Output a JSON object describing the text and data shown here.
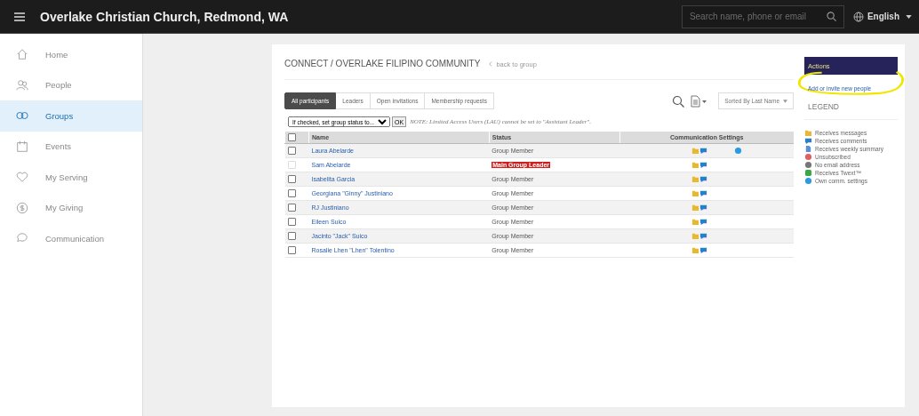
{
  "header": {
    "title": "Overlake Christian Church, Redmond, WA",
    "search": {
      "placeholder": "Search name, phone or email"
    },
    "language": "English"
  },
  "sidebar": {
    "items": [
      {
        "label": "Home",
        "selected": false
      },
      {
        "label": "People",
        "selected": false
      },
      {
        "label": "Groups",
        "selected": true
      },
      {
        "label": "Events",
        "selected": false
      },
      {
        "label": "My Serving",
        "selected": false
      },
      {
        "label": "My Giving",
        "selected": false
      },
      {
        "label": "Communication",
        "selected": false
      }
    ]
  },
  "breadcrumb": {
    "title": "CONNECT / OVERLAKE FILIPINO COMMUNITY",
    "back_link": "back to group"
  },
  "tabs": [
    {
      "label": "All participants",
      "selected": true
    },
    {
      "label": "Leaders",
      "selected": false
    },
    {
      "label": "Open invitations",
      "selected": false
    },
    {
      "label": "Membership requests",
      "selected": false
    }
  ],
  "sort": {
    "value": "Sorted By Last Name"
  },
  "bulk": {
    "select": "If checked, set group status to...",
    "button": "OK",
    "note": "NOTE: Limited Access Users (LAU) cannot be set to \"Assistant Leader\"."
  },
  "table": {
    "select_all_checked": false,
    "columns": [
      "Name",
      "Status",
      "Communication Settings"
    ],
    "rows": [
      {
        "name": "Laura Abelarde",
        "status": "Group Member",
        "leader": false,
        "checked": false,
        "disabled": false,
        "comm": [
          {
            "kind": "messages"
          },
          {
            "kind": "comments"
          },
          {
            "kind": "own"
          }
        ]
      },
      {
        "name": "Sam Abelarde",
        "status": "Main Group Leader",
        "leader": true,
        "checked": false,
        "disabled": true,
        "comm": [
          {
            "kind": "messages"
          },
          {
            "kind": "comments"
          }
        ]
      },
      {
        "name": "Isabelita Garcia",
        "status": "Group Member",
        "leader": false,
        "checked": false,
        "disabled": false,
        "comm": [
          {
            "kind": "messages"
          },
          {
            "kind": "comments"
          }
        ]
      },
      {
        "name": "Georgiana \"Ginny\" Justiniano",
        "status": "Group Member",
        "leader": false,
        "checked": false,
        "disabled": false,
        "comm": [
          {
            "kind": "messages"
          },
          {
            "kind": "comments"
          }
        ]
      },
      {
        "name": "RJ Justiniano",
        "status": "Group Member",
        "leader": false,
        "checked": false,
        "disabled": false,
        "comm": [
          {
            "kind": "messages"
          },
          {
            "kind": "comments"
          }
        ]
      },
      {
        "name": "Eileen Suico",
        "status": "Group Member",
        "leader": false,
        "checked": false,
        "disabled": false,
        "comm": [
          {
            "kind": "messages"
          },
          {
            "kind": "comments"
          }
        ]
      },
      {
        "name": "Jacinto \"Jack\" Suico",
        "status": "Group Member",
        "leader": false,
        "checked": false,
        "disabled": false,
        "comm": [
          {
            "kind": "messages"
          },
          {
            "kind": "comments"
          }
        ]
      },
      {
        "name": "Rosalie Lhen \"Lhen\" Tolentino",
        "status": "Group Member",
        "leader": false,
        "checked": false,
        "disabled": false,
        "comm": [
          {
            "kind": "messages"
          },
          {
            "kind": "comments"
          }
        ]
      }
    ]
  },
  "actions": {
    "title": "Actions",
    "link": "Add or invite new people"
  },
  "legend": {
    "title": "LEGEND",
    "items": [
      {
        "kind": "messages",
        "label": "Receives messages"
      },
      {
        "kind": "comments",
        "label": "Receives comments"
      },
      {
        "kind": "summary",
        "label": "Receives weekly summary"
      },
      {
        "kind": "unsubscribed",
        "label": "Unsubscribed"
      },
      {
        "kind": "noemail",
        "label": "No email address"
      },
      {
        "kind": "twext",
        "label": "Receives Twext™"
      },
      {
        "kind": "own",
        "label": "Own comm. settings"
      }
    ]
  }
}
